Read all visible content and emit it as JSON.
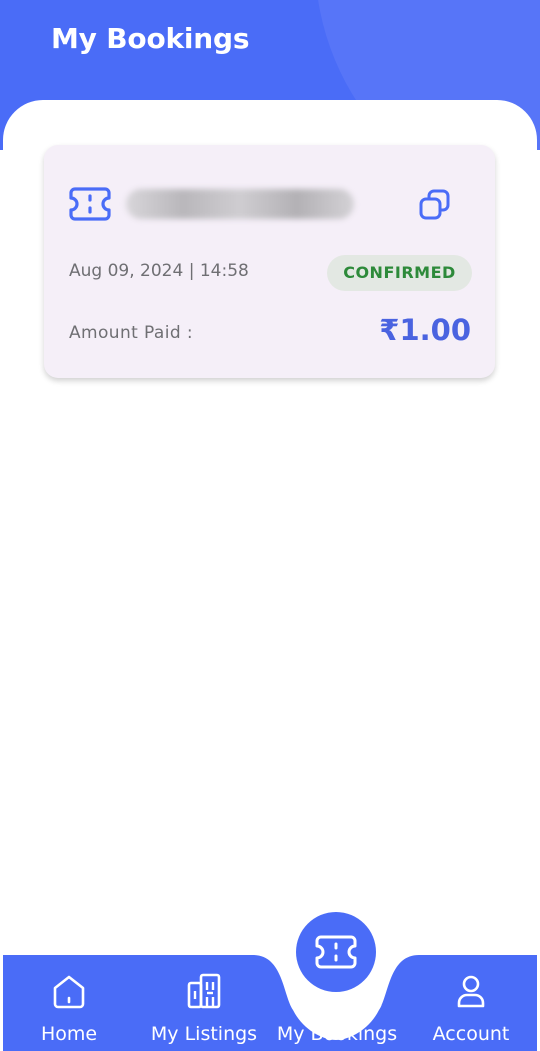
{
  "header": {
    "title": "My Bookings"
  },
  "booking": {
    "datetime": "Aug 09, 2024 | 14:58",
    "status": "CONFIRMED",
    "amount_label": "Amount Paid :",
    "amount": "₹1.00",
    "icons": {
      "ticket": "ticket-icon",
      "copy": "copy-icon"
    }
  },
  "nav": {
    "items": [
      {
        "label": "Home",
        "icon": "home-icon"
      },
      {
        "label": "My Listings",
        "icon": "building-icon"
      },
      {
        "label": "My Bookings",
        "icon": "ticket-icon",
        "active": true
      },
      {
        "label": "Account",
        "icon": "user-icon"
      }
    ]
  },
  "colors": {
    "primary": "#4a6cf7",
    "card_bg": "#f5eff8",
    "status_text": "#2d8a3a",
    "status_bg": "#e3e8e3",
    "amount": "#4a63e0"
  }
}
